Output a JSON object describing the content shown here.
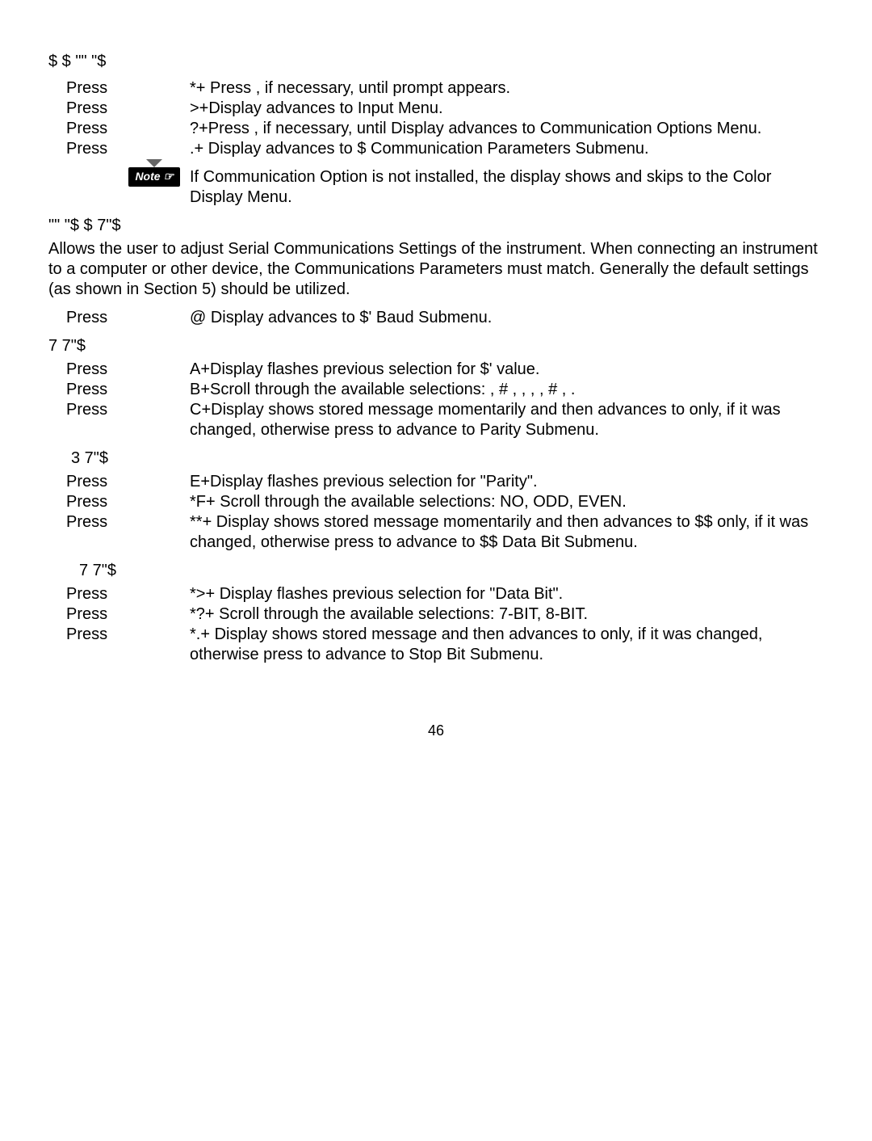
{
  "header1": "$  $    \"\"              \"$",
  "steps1": [
    {
      "left": "Press",
      "right": "*+ Press   , if necessary, until         prompt appears."
    },
    {
      "left": "Press",
      "right": ">+Display advances to          Input Menu."
    },
    {
      "left": "Press",
      "right": "?+Press   , if necessary, until Display advances to            Communication Options Menu."
    },
    {
      "left": "Press",
      "right": ".+ Display advances to   $     Communication Parameters Submenu."
    }
  ],
  "note": "If Communication Option is not installed, the display shows             and skips to the Color Display Menu.",
  "header2": "\"\"            \"$ $    7\"$",
  "intro": "Allows the user to adjust Serial Communications Settings of the instrument. When connecting an instrument to a computer or other device, the Communications Parameters must match. Generally the default settings (as shown in Section 5) should be utilized.",
  "step2_left": "Press",
  "step2_right": "@ Display advances to  $'       Baud Submenu.",
  "sub_baud": "7    7\"$",
  "baud_steps": [
    {
      "left": "Press",
      "right": "A+Display flashes previous selection for  $'       value."
    },
    {
      "left": "Press",
      "right": "B+Scroll through the available selections:          , #      ,         ,           ,         ,   #     ,        ."
    },
    {
      "left": "Press",
      "right": "C+Display shows          stored message momentarily and then advances to           only, if it was changed, otherwise press     to advance to          Parity Submenu."
    }
  ],
  "sub_parity": "3   7\"$",
  "parity_steps": [
    {
      "left": "Press",
      "right": "E+Display flashes previous selection for \"Parity\"."
    },
    {
      "left": "Press",
      "right": "*F+ Scroll through the available selections: NO, ODD, EVEN."
    },
    {
      "left": "Press",
      "right": "**+ Display shows           stored message momentarily and then advances to  $$     only, if it was changed, otherwise press     to advance to  $$    Data Bit Submenu."
    }
  ],
  "sub_databit": "7    7\"$",
  "databit_steps": [
    {
      "left": "Press",
      "right": "*>+ Display flashes previous selection for \"Data Bit\"."
    },
    {
      "left": "Press",
      "right": "*?+ Scroll through the available selections: 7-BIT, 8-BIT."
    },
    {
      "left": "Press",
      "right": "*.+  Display shows           stored message and then advances to             only, if it was changed, otherwise press    to advance to           Stop Bit Submenu."
    }
  ],
  "pagenum": "46",
  "note_label": "Note ☞"
}
